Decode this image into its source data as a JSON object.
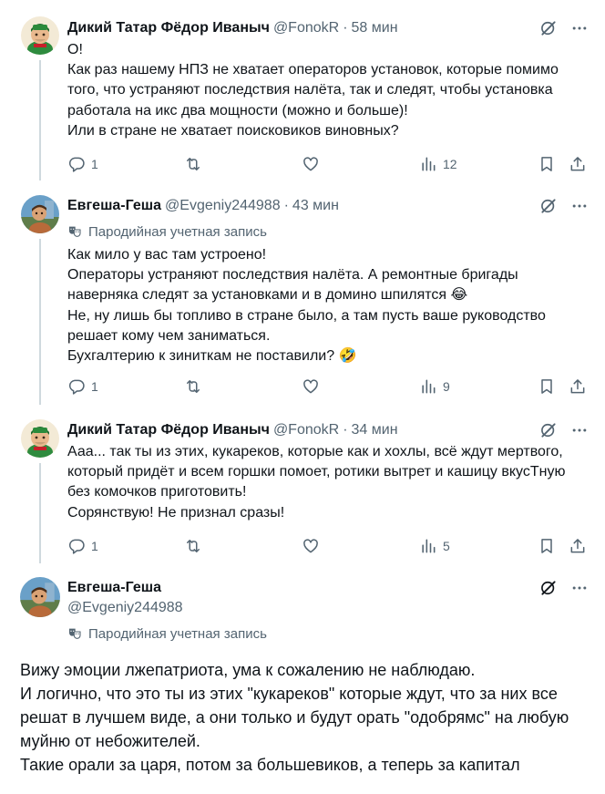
{
  "posts": [
    {
      "name": "Дикий Татар Фёдор Иваныч",
      "handle": "@FonokR",
      "time": "58 мин",
      "lines": [
        "О!",
        "Как раз нашему НПЗ не хватает операторов установок, которые помимо",
        "того, что устраняют последствия налёта, так и следят, чтобы установка",
        "работала на икс два мощности (можно и больше)!",
        "Или в стране не хватает поисковиков виновных?"
      ],
      "replies": "1",
      "views": "12"
    },
    {
      "name": "Евгеша-Геша",
      "handle": "@Evgeniy244988",
      "time": "43 мин",
      "badge": "Пародийная учетная запись",
      "lines": [
        "Как мило у вас там устроено!",
        "Операторы устраняют последствия налёта. А ремонтные бригады",
        "наверняка следят за установками и в домино шпилятся 😂",
        "Не, ну лишь бы топливо в стране было, а там пусть ваше руководство",
        "решает кому чем заниматься.",
        "Бухгалтерию к зиниткам не поставили? 🤣"
      ],
      "replies": "1",
      "views": "9"
    },
    {
      "name": "Дикий Татар Фёдор Иваныч",
      "handle": "@FonokR",
      "time": "34 мин",
      "lines": [
        "Ааа... так ты из этих, кукареков, которые как и хохлы, всё ждут мертвого,",
        "который придёт и всем горшки помоет, ротики вытрет и кашицу вкусТную",
        "без комочков приготовить!",
        "Сорянствую! Не признал сразы!"
      ],
      "replies": "1",
      "views": "5"
    }
  ],
  "main_post": {
    "name": "Евгеша-Геша",
    "handle": "@Evgeniy244988",
    "badge": "Пародийная учетная запись",
    "lines": [
      "Вижу эмоции лжепатриота, ума к сожалению не наблюдаю.",
      "И логично, что это ты из этих \"кукареков\" которые  ждут, что за них все",
      "решат в лучшем виде, а они только и будут орать \"одобрямс\" на любую",
      "муйню от небожителей.",
      "Такие орали за царя, потом за большевиков, а теперь за капитал"
    ]
  },
  "icons": {
    "grok": "grok-icon",
    "more": "more-icon",
    "reply": "reply-icon",
    "repost": "repost-icon",
    "like": "like-icon",
    "views": "views-icon",
    "bookmark": "bookmark-icon",
    "share": "share-icon",
    "parody": "theater-mask-icon"
  },
  "colors": {
    "text": "#0f1419",
    "secondary": "#536471",
    "thread_line": "#cfd9de",
    "divider": "#eff3f4"
  }
}
